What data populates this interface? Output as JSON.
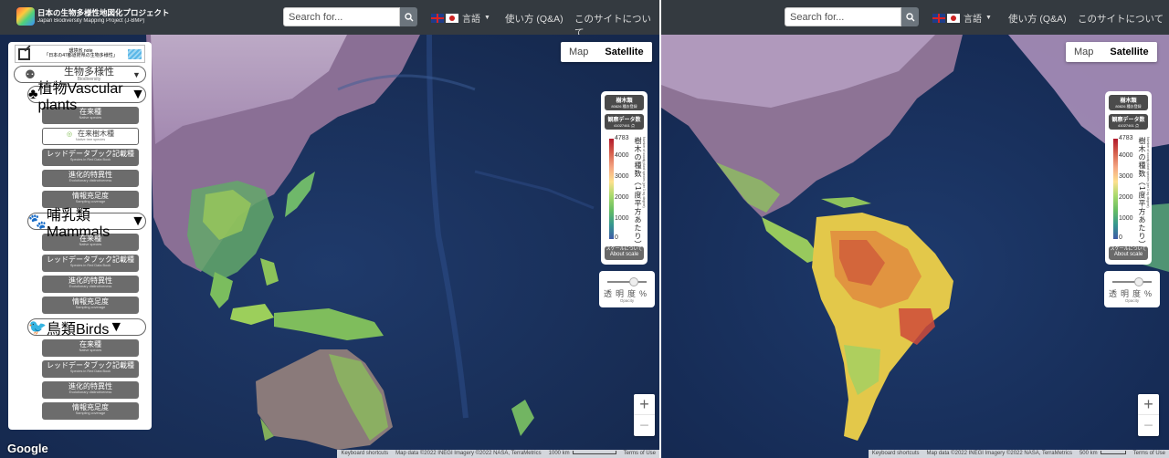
{
  "site": {
    "title": "日本の生物多様性地図化プロジェクト",
    "subtitle": "Japan Biodiversity Mapping Project (J-BMP)"
  },
  "nav": {
    "search_placeholder": "Search for...",
    "language_label": "言語",
    "howto_label": "使い方 (Q&A)",
    "about_label": "このサイトについて"
  },
  "map_type": {
    "map_label": "Map",
    "satellite_label": "Satellite",
    "selected": "Satellite"
  },
  "legend": {
    "title": "樹木類",
    "title_sub": "80826 種お登録",
    "obs_title": "観察データ数",
    "obs_sub": "41027461 点",
    "max": "4783",
    "ticks": [
      "4000",
      "3000",
      "2000",
      "1000",
      "0"
    ],
    "vertical_label": "樹木の種数（1度平方あたり）",
    "vertical_sub": "Number of woody plant species (per 1 sq. degree)",
    "scale_jp": "スケールについて",
    "scale_en": "About scale"
  },
  "opacity": {
    "label": "透明度%",
    "sub": "Opacity",
    "value": 0.7
  },
  "zoom": {
    "in": "+",
    "out": "−"
  },
  "attribution": {
    "shortcuts": "Keyboard shortcuts",
    "mapdata": "Map data ©2022 INEGI Imagery ©2022 NASA, TerraMetrics",
    "scale_left": "1000 km",
    "scale_right": "500 km",
    "terms": "Terms of Use",
    "google": "Google"
  },
  "sidebar": {
    "banner_jp": "環境省 note",
    "banner_sub": "「日本の47都道府県の生物多様性」",
    "groups": [
      {
        "jp": "生物多様性",
        "en": "Biodiversity",
        "icon": "dots-icon"
      },
      {
        "jp": "植物",
        "en": "Vascular plants",
        "icon": "tree-icon",
        "buttons": [
          {
            "jp": "在来種",
            "en": "Native species"
          },
          {
            "jp": "在来樹木種",
            "en": "Native tree species",
            "active": true
          },
          {
            "jp": "レッドデータブック記載種",
            "en": "Species in Red Data Book"
          },
          {
            "jp": "進化的特異性",
            "en": "Evolutionary distinctiveness"
          },
          {
            "jp": "情報充足度",
            "en": "Sampling coverage"
          }
        ]
      },
      {
        "jp": "哺乳類",
        "en": "Mammals",
        "icon": "mammal-icon",
        "buttons": [
          {
            "jp": "在来種",
            "en": "Native species"
          },
          {
            "jp": "レッドデータブック記載種",
            "en": "Species in Red Data Book"
          },
          {
            "jp": "進化的特異性",
            "en": "Evolutionary distinctiveness"
          },
          {
            "jp": "情報充足度",
            "en": "Sampling coverage"
          }
        ]
      },
      {
        "jp": "鳥類",
        "en": "Birds",
        "icon": "bird-icon",
        "buttons": [
          {
            "jp": "在来種",
            "en": "Native species"
          },
          {
            "jp": "レッドデータブック記載種",
            "en": "Species in Red Data Book"
          },
          {
            "jp": "進化的特異性",
            "en": "Evolutionary distinctiveness"
          },
          {
            "jp": "情報充足度",
            "en": "Sampling coverage"
          }
        ]
      }
    ]
  },
  "colors": {
    "navbar": "#343a40",
    "ocean": "#1f3d73",
    "ramp_high": "#b2182b",
    "ramp_low": "#3f5ba7"
  }
}
